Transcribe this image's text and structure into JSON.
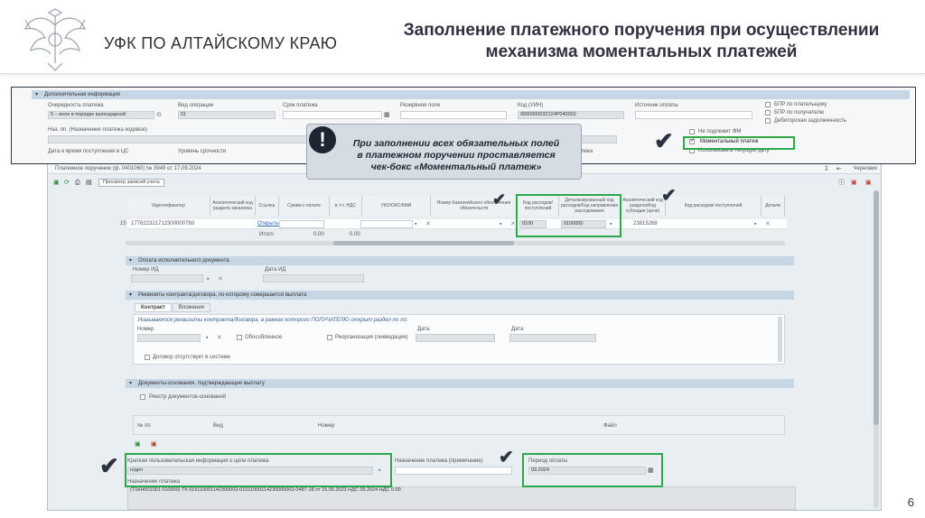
{
  "slide": {
    "org_name": "УФК ПО АЛТАЙСКОМУ КРАЮ",
    "title_line1": "Заполнение платежного поручения при осуществлении",
    "title_line2": "механизма моментальных платежей",
    "page_number": "6"
  },
  "callout": {
    "icon": "!",
    "line1": "При заполнении всех обязательных полей",
    "line2": "в платежном поручении проставляется",
    "line3": "чек-бокс «Моментальный платеж»"
  },
  "top_panel": {
    "section_title": "Дополнительная информация",
    "fields": {
      "priority_label": "Очередность платежа",
      "priority_value": "5 – иное в порядке календарной",
      "operation_type_label": "Вид операции",
      "operation_type_value": "01",
      "due_date_label": "Срок платежа",
      "reserve_label": "Резервное поле",
      "uin_label": "Код (УИН)",
      "uin_value": "0000000032124Р040002",
      "payment_source_label": "Источник оплаты",
      "purpose_code_label": "Наз. пп. (Назначение платежа кодовое)",
      "receipt_date_label": "Дата и время поступления в ЦС",
      "urgency_label": "Уровень срочности",
      "payment_label": "платежа"
    },
    "checkboxes": {
      "payer_bpr": "БПР по плательщику",
      "recipient_bpr": "БПР по получателю",
      "receivables": "Дебиторская задолженность",
      "not_tied_fm": "Не подлежит ФМ",
      "instant_payment": "Моментальный платеж",
      "use_current_date": "Использовать текущую дату"
    }
  },
  "document": {
    "title": "Платежное поручение (ф. 0401060) № 3949 от 17.09.2024",
    "toolbar_view_records": "Просмотр записей учета",
    "watched_label": "Черновик",
    "columns": {
      "identifier": "Идентификатор",
      "analytic_code": "Аналитический код раздела заказчика",
      "link": "Ссылка",
      "amount": "Сумма к оплате",
      "vat": "в т.ч. НДС",
      "ukoks": "УКО/ОКС/КМИ",
      "treasury_number": "Номер Казначейского обеспечения обязательств",
      "expense_code": "Код расходов/ поступлений",
      "detailed_code": "Детализированный код расходов/Код направления расходования",
      "subsidy_code": "Аналитический код раздела/Код субсидии (цели)",
      "expense_code2": "Код расходов/ поступлений",
      "detail_right": "Детали"
    },
    "row": {
      "num": "15",
      "identifier": "177622321712300000780",
      "link": "Открыть",
      "expense_code": "0100",
      "detailed_code": "0100000",
      "subsidy_code": "23815268"
    },
    "totals": {
      "label": "Итого",
      "amount": "0.00",
      "vat": "0.00"
    },
    "exec_doc": {
      "section_title": "Оплата исполнительного документа",
      "id_number_label": "Номер ИД",
      "id_date_label": "Дата ИД"
    },
    "contract": {
      "section_title": "Реквизиты контракта/договора, по которому совершается выплата",
      "tab_contract": "Контракт",
      "tab_attachments": "Вложения",
      "note": "Указываются реквизиты контракта/договора, в рамках которого ПОЛУЧАТЕЛЮ открыт раздел по л/с",
      "number_label": "Номер",
      "separate_label": "Обособленное",
      "reorg_label": "Реорганизация (ликвидация)",
      "date_label": "Дата",
      "date2_label": "Дата",
      "missing_label": "Договор отсутствует в системе"
    },
    "basis_docs": {
      "section_title": "Документы-основания, подтверждающие выплату",
      "registry_label": "Реестр документов-оснований",
      "col_num": "№ пп",
      "col_type": "Вид",
      "col_number": "Номер",
      "col_file": "Файл"
    },
    "bottom": {
      "short_info_label": "Краткая пользовательская информация о цели платежа",
      "short_info_value": "н/дел",
      "purpose_note_label": "Назначение платежа (примечание)",
      "period_label": "Период оплаты",
      "period_value": "09.2024",
      "purpose_label": "Назначение платежа",
      "purpose_value": "(Т1КН501001 010000) ТК 015110001142300003-01511000114230000003-0487-18 от 15.05.2023 НДС 09.2024 НДС 0.00"
    }
  },
  "colors": {
    "accent_green": "#2aa84a",
    "section_header": "#c7d6e4",
    "callout_bg": "#d5dce4"
  }
}
